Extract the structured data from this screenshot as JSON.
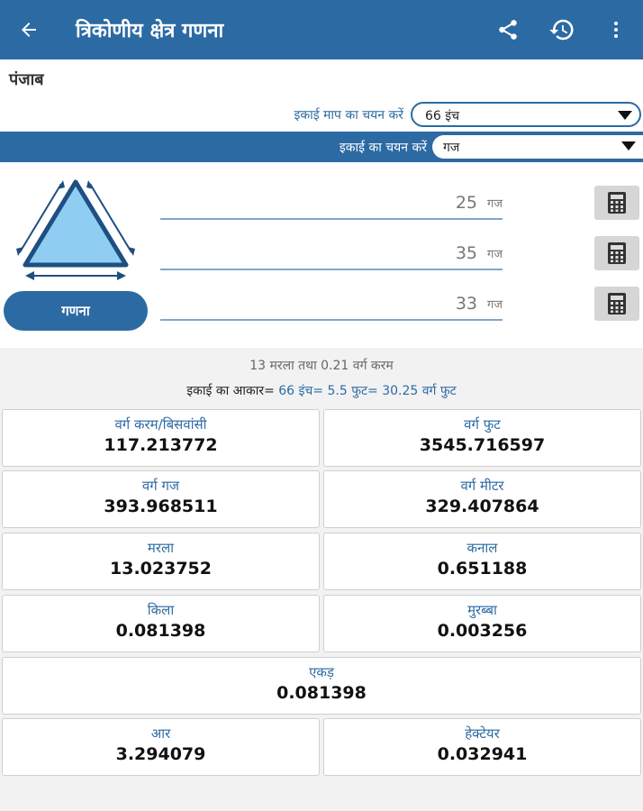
{
  "appbar": {
    "title": "त्रिकोणीय क्षेत्र गणना",
    "icons": [
      "back-arrow-icon",
      "share-icon",
      "history-icon",
      "more-vert-icon"
    ]
  },
  "region": "पंजाब",
  "measure": {
    "label": "इकाई माप का चयन करें",
    "selected": "66 इंच"
  },
  "unit": {
    "label": "इकाई का चयन करें",
    "selected": "गज"
  },
  "sides": [
    {
      "value": "25",
      "unit": "गज"
    },
    {
      "value": "35",
      "unit": "गज"
    },
    {
      "value": "33",
      "unit": "गज"
    }
  ],
  "calculate_label": "गणना",
  "summary": {
    "line1": "13 मरला तथा 0.21 वर्ग करम",
    "size_label": "इकाई का आकार=",
    "size_values": "66 इंच= 5.5 फुट= 30.25 वर्ग फुट"
  },
  "results": [
    {
      "label": "वर्ग करम/बिसवांसी",
      "value": "117.213772"
    },
    {
      "label": "वर्ग फुट",
      "value": "3545.716597"
    },
    {
      "label": "वर्ग गज",
      "value": "393.968511"
    },
    {
      "label": "वर्ग मीटर",
      "value": "329.407864"
    },
    {
      "label": "मरला",
      "value": "13.023752"
    },
    {
      "label": "कनाल",
      "value": "0.651188"
    },
    {
      "label": "किला",
      "value": "0.081398"
    },
    {
      "label": "मुरब्बा",
      "value": "0.003256"
    },
    {
      "label": "एकड़",
      "value": "0.081398"
    },
    {
      "label": "आर",
      "value": "3.294079"
    },
    {
      "label": "हेक्टेयर",
      "value": "0.032941"
    }
  ],
  "colors": {
    "primary": "#2c6aa3",
    "triangle_fill": "#8fcdf2",
    "background": "#f2f2f2"
  }
}
